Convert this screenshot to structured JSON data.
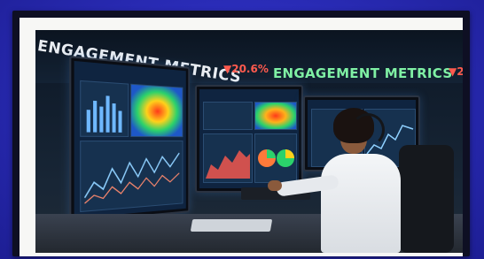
{
  "ticker": {
    "left_text": "ENGAGEMENT METRICS",
    "change": "▼20.6%",
    "right_text": "ENGAGEMENT METRICS",
    "right_arrow": "▼2"
  },
  "colors": {
    "background": "#2a2cb8",
    "change_red": "#ff5a4e",
    "ticker_green": "#7ff0a4"
  }
}
